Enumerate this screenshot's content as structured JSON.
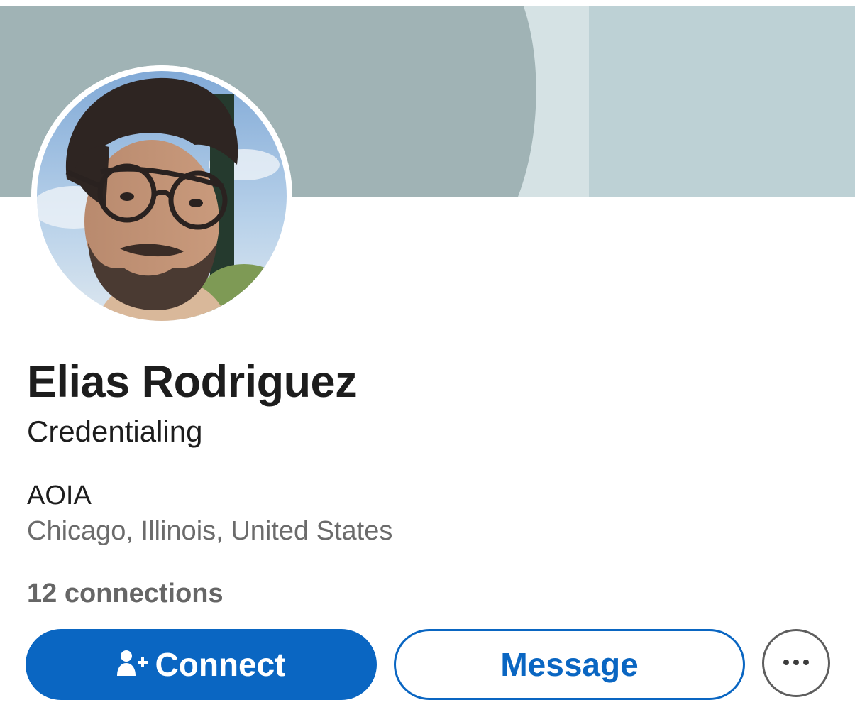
{
  "profile": {
    "name": "Elias Rodriguez",
    "headline": "Credentialing",
    "company": "AOIA",
    "location": "Chicago, Illinois, United States",
    "connections": "12 connections"
  },
  "actions": {
    "connect_label": "Connect",
    "connect_icon": "add-person-icon",
    "message_label": "Message",
    "more_icon": "ellipsis-icon"
  },
  "colors": {
    "brand_blue": "#0a66c2",
    "banner_dark": "#a0b3b5",
    "banner_light": "#bdd1d5",
    "banner_stripe": "#d5e2e4"
  }
}
